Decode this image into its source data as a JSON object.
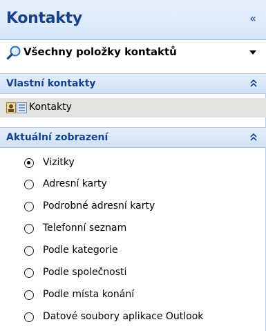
{
  "pane": {
    "title": "Kontakty",
    "collapse_glyph": "«"
  },
  "view_selector": {
    "icon": "magnifier-icon",
    "label": "Všechny položky kontaktů",
    "dropdown_icon": "dropdown-arrow-icon"
  },
  "my_contacts": {
    "header": "Vlastní kontakty",
    "chevron_icon": "double-chevron-up-icon",
    "folders": [
      {
        "icon": "contact-card-icon",
        "label": "Kontakty",
        "selected": true
      }
    ]
  },
  "current_view": {
    "header": "Aktuální zobrazení",
    "chevron_icon": "double-chevron-up-icon",
    "options": [
      {
        "label": "Vizitky",
        "checked": true
      },
      {
        "label": "Adresní karty",
        "checked": false
      },
      {
        "label": "Podrobné adresní karty",
        "checked": false
      },
      {
        "label": "Telefonní seznam",
        "checked": false
      },
      {
        "label": "Podle kategorie",
        "checked": false
      },
      {
        "label": "Podle společnosti",
        "checked": false
      },
      {
        "label": "Podle místa konání",
        "checked": false
      },
      {
        "label": "Datové soubory aplikace Outlook",
        "checked": false
      }
    ]
  },
  "colors": {
    "title": "#15428b",
    "header_bg": "#d5e5f8",
    "selected_row": "#e4e2dc"
  }
}
